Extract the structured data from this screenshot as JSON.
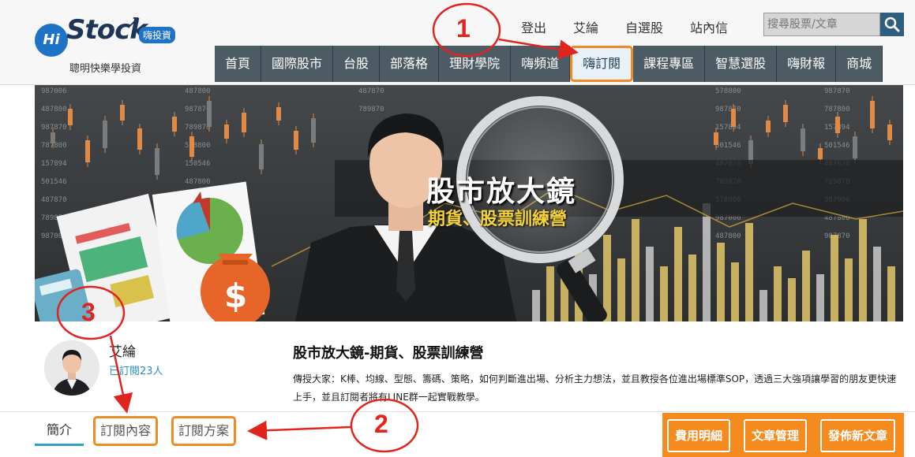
{
  "logo": {
    "hi": "Hi",
    "stock": "Stock",
    "badge": "嗨投資",
    "slogan": "聰明快樂學投資"
  },
  "top_links": [
    "登出",
    "艾綸",
    "自選股",
    "站內信"
  ],
  "search": {
    "placeholder": "搜尋股票/文章"
  },
  "nav": {
    "items": [
      "首頁",
      "國際股市",
      "台股",
      "部落格",
      "理財學院",
      "嗨頻道",
      "嗨訂閱",
      "課程專區",
      "智慧選股",
      "嗨財報",
      "商城"
    ],
    "active": "嗨訂閱"
  },
  "banner": {
    "title": "股市放大鏡",
    "subtitle": "期貨、股票訓練營",
    "ticker_numbers": [
      "987006",
      "487800",
      "987870",
      "787800",
      "157894",
      "501546",
      "487870",
      "789870",
      "987006",
      "487800",
      "987870",
      "789870",
      "578800",
      "150546",
      "487800",
      "987870",
      "157894",
      "501546",
      "487870",
      "789870",
      "578800",
      "987870",
      "157894",
      "501546",
      "487870",
      "789870",
      "578800"
    ]
  },
  "profile": {
    "author": "艾綸",
    "subscribers": "已訂閱23人"
  },
  "course": {
    "title": "股市放大鏡-期貨、股票訓練營",
    "description": "傳授大家：K棒、均線、型態、籌碼、策略，如何判斷進出場、分析主力想法，並且教授各位進出場標準SOP，透過三大強項讓學習的朋友更快速上手，並且訂閱者將有LINE群一起實戰教學。"
  },
  "tabs": [
    "簡介",
    "訂閱內容",
    "訂閱方案"
  ],
  "actions": [
    "費用明細",
    "文章管理",
    "發佈新文章"
  ],
  "annotations": [
    "1",
    "2",
    "3"
  ],
  "colors": {
    "nav_bg": "#4c5b64",
    "highlight": "#f08a24",
    "annotation": "#e2241f",
    "action_bg": "#f58a1f",
    "link": "#2a8fb8"
  }
}
